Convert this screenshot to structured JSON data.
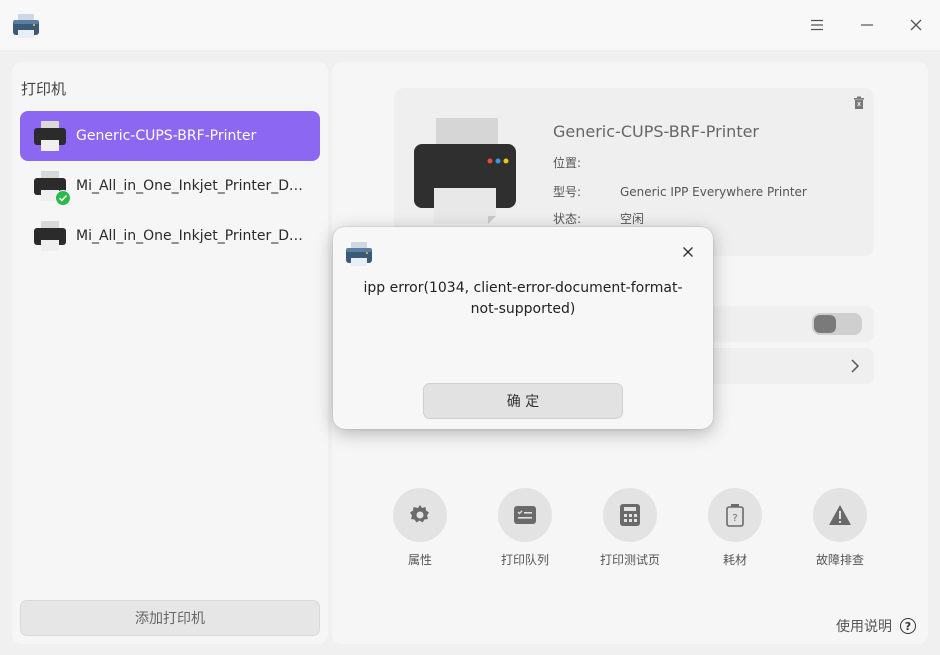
{
  "window": {
    "icons": {
      "app": "printer-app-icon",
      "menu": "menu-icon",
      "minimize": "minimize-icon",
      "close": "close-icon"
    }
  },
  "sidebar": {
    "title": "打印机",
    "printers": [
      {
        "label": "Generic-CUPS-BRF-Printer",
        "selected": true,
        "default": false
      },
      {
        "label": "Mi_All_in_One_Inkjet_Printer_DA…",
        "selected": false,
        "default": true
      },
      {
        "label": "Mi_All_in_One_Inkjet_Printer_DA…",
        "selected": false,
        "default": false
      }
    ],
    "add_button": "添加打印机"
  },
  "details": {
    "name": "Generic-CUPS-BRF-Printer",
    "location_label": "位置:",
    "location_value": "",
    "model_label": "型号:",
    "model_value": "Generic IPP Everywhere Printer",
    "status_label": "状态:",
    "status_value": "空闲"
  },
  "tools": [
    {
      "label": "属性",
      "icon": "gear-icon"
    },
    {
      "label": "打印队列",
      "icon": "queue-icon"
    },
    {
      "label": "打印测试页",
      "icon": "test-page-icon"
    },
    {
      "label": "耗材",
      "icon": "supplies-icon"
    },
    {
      "label": "故障排查",
      "icon": "warning-icon"
    }
  ],
  "help": {
    "label": "使用说明"
  },
  "dialog": {
    "message": "ipp error(1034, client-error-document-format-not-supported)",
    "ok_label": "确 定"
  },
  "colors": {
    "accent": "#8c67f2",
    "success": "#2ab84a"
  }
}
